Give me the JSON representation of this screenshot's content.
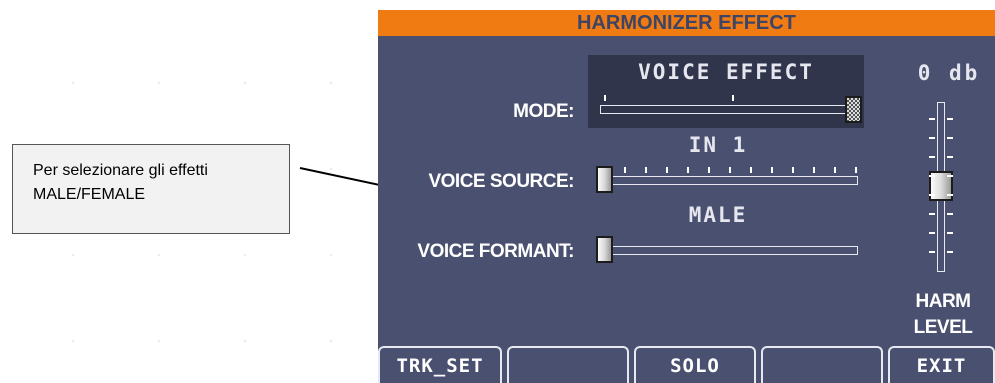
{
  "callout": {
    "line1": "Per selezionare gli effetti",
    "line2": "MALE/FEMALE"
  },
  "screen": {
    "title": "HARMONIZER EFFECT",
    "mode": {
      "label": "MODE:",
      "value": "VOICE EFFECT",
      "level": 1.0
    },
    "voice_source": {
      "label": "VOICE SOURCE:",
      "value": "IN 1",
      "level": 0.0
    },
    "voice_formant": {
      "label": "VOICE FORMANT:",
      "value": "MALE",
      "level": 0.0
    },
    "harm_level": {
      "db_readout": "0 db",
      "label_line1": "HARM",
      "label_line2": "LEVEL",
      "level": 0.5
    },
    "buttons": [
      {
        "label": "TRK_SET"
      },
      {
        "label": ""
      },
      {
        "label": "SOLO"
      },
      {
        "label": ""
      },
      {
        "label": "EXIT"
      }
    ]
  },
  "colors": {
    "title_bar": "#f07b13",
    "screen_bg": "#4a5170",
    "panel_bg": "#30354c"
  }
}
